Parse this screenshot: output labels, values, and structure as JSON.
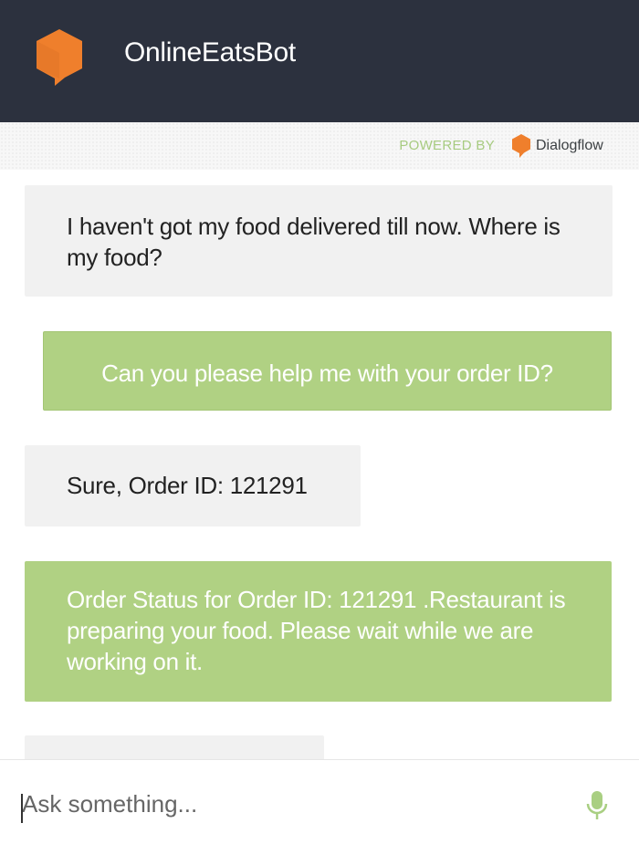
{
  "header": {
    "title": "OnlineEatsBot",
    "logo_icon": "chat-bubble-hexagon-icon",
    "background": "#2c313e",
    "logo_color": "#ef7f2c"
  },
  "powered_by": {
    "label": "POWERED BY",
    "brand": "Dialogflow",
    "brand_icon": "dialogflow-logo-icon",
    "label_color": "#a7cb80"
  },
  "messages": [
    {
      "sender": "user",
      "text": "I haven't got my food delivered till now. Where is my food?"
    },
    {
      "sender": "bot",
      "text": "Can you please help me with your order ID?"
    },
    {
      "sender": "user",
      "text": "Sure, Order ID: 121291"
    },
    {
      "sender": "bot",
      "text": "Order Status for Order ID: 121291 .Restaurant is preparing your food. Please wait while we are working on it."
    }
  ],
  "colors": {
    "user_bubble": "#f1f1f1",
    "bot_bubble": "#b0d183"
  },
  "composer": {
    "placeholder": "Ask something...",
    "value": "",
    "mic_icon": "microphone-icon"
  }
}
